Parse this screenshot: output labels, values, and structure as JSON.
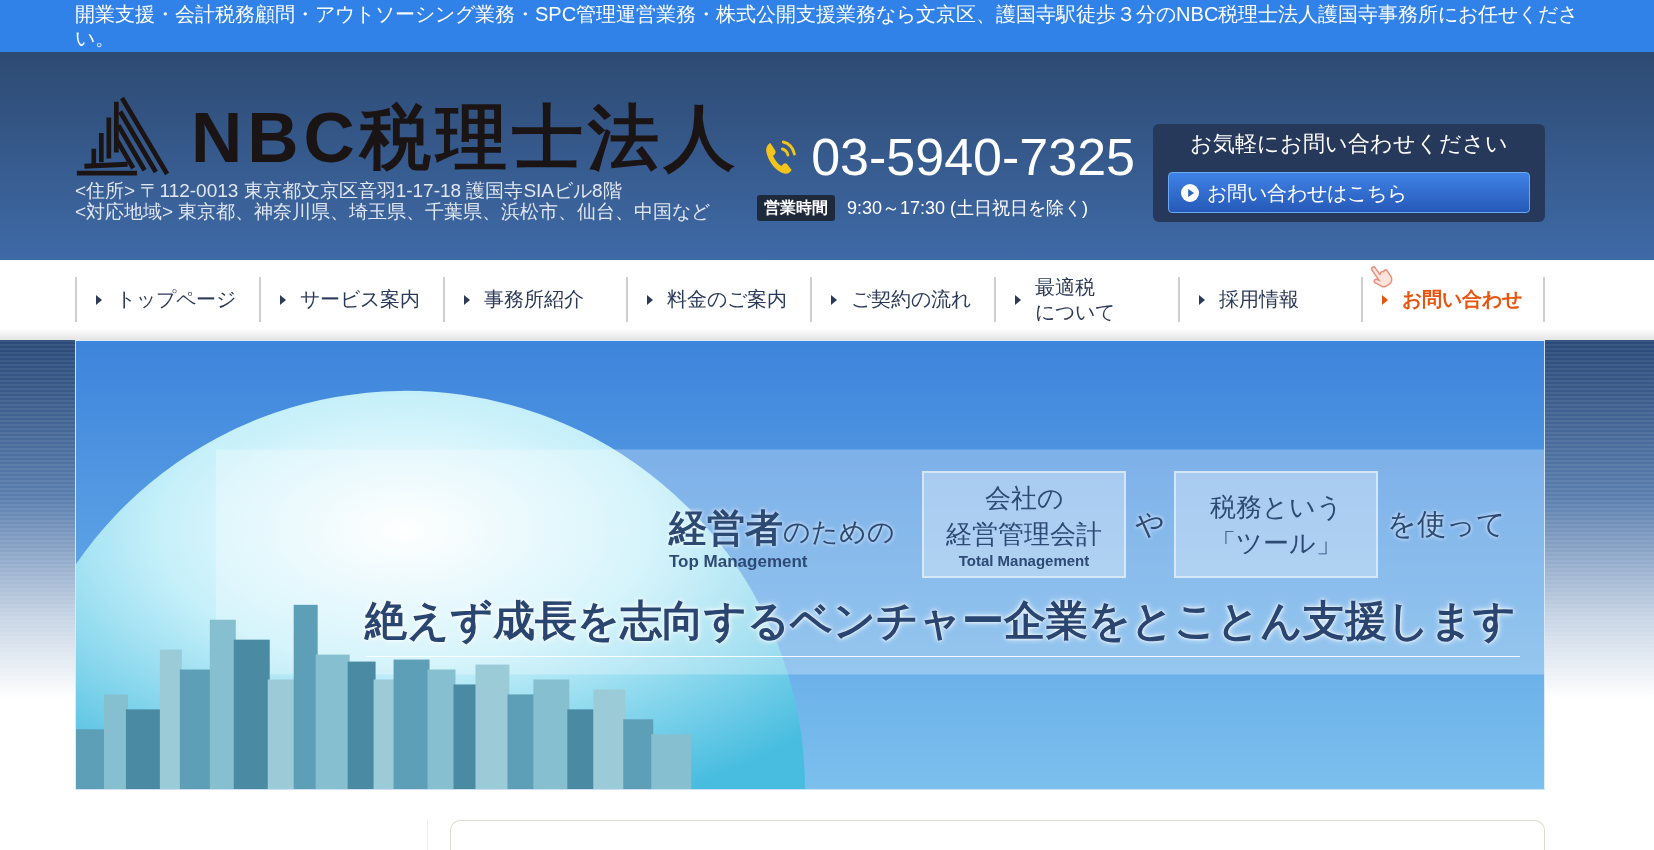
{
  "top_bar": {
    "text": "開業支援・会計税務顧問・アウトソーシング業務・SPC管理運営業務・株式公開支援業務なら文京区、護国寺駅徒歩３分のNBC税理士法人護国寺事務所にお任せください。"
  },
  "header": {
    "logo": "NBC税理士法人",
    "address_lines": [
      "<住所> 〒112-0013 東京都文京区音羽1-17-18 護国寺SIAビル8階",
      "<対応地域> 東京都、神奈川県、埼玉県、千葉県、浜松市、仙台、中国など"
    ],
    "phone": "03-5940-7325",
    "hours_label": "営業時間",
    "hours": "9:30～17:30 (土日祝日を除く)",
    "contact_box": {
      "title": "お気軽にお問い合わせください",
      "button": "お問い合わせはこちら"
    }
  },
  "nav": [
    {
      "label": "トップページ",
      "kind": "link"
    },
    {
      "label": "サービス案内",
      "kind": "link"
    },
    {
      "label": "事務所紹介",
      "kind": "link"
    },
    {
      "label": "料金のご案内",
      "kind": "link"
    },
    {
      "label": "ご契約の流れ",
      "kind": "link"
    },
    {
      "label": "最適税について",
      "kind": "link"
    },
    {
      "label": "採用情報",
      "kind": "link"
    },
    {
      "label": "お問い合わせ",
      "kind": "contact"
    }
  ],
  "banner": {
    "lead": {
      "text": "**経営者**のための",
      "sub": "Top Management"
    },
    "phrases": [
      {
        "kind": "panel",
        "lines": [
          "会社の",
          "経営管理会計"
        ],
        "sub": "Total Management"
      },
      {
        "kind": "plain",
        "text": "や"
      },
      {
        "kind": "panel",
        "lines": [
          "税務という",
          "「ツール」"
        ]
      },
      {
        "kind": "plain",
        "text": "を使って"
      }
    ],
    "headline": "絶えず成長を志向するベンチャー企業をとことん支援します"
  }
}
